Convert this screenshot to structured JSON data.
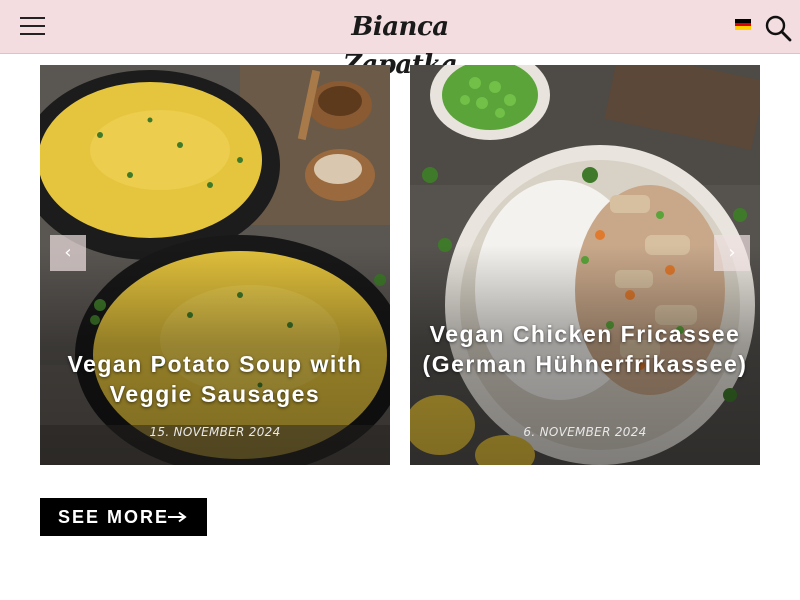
{
  "header": {
    "logo": "Bianca Zapatka",
    "menu_icon": "hamburger-menu-icon",
    "language_icon": "german-flag-icon",
    "search_icon": "search-icon"
  },
  "slider": {
    "prev_icon": "chevron-left-icon",
    "next_icon": "chevron-right-icon",
    "prev_label": "‹",
    "next_label": "›",
    "posts": [
      {
        "title": "Vegan Potato Soup with Veggie Sausages",
        "date": "15. NOVEMBER 2024"
      },
      {
        "title": "Vegan Chicken Fricassee (German Hühnerfrikassee)",
        "date": "6. NOVEMBER 2024"
      }
    ]
  },
  "see_more": {
    "label": "SEE MORE",
    "icon": "arrow-right-icon"
  },
  "colors": {
    "header_bg": "#f3dde0",
    "button_bg": "#000000",
    "text_light": "#ffffff"
  }
}
